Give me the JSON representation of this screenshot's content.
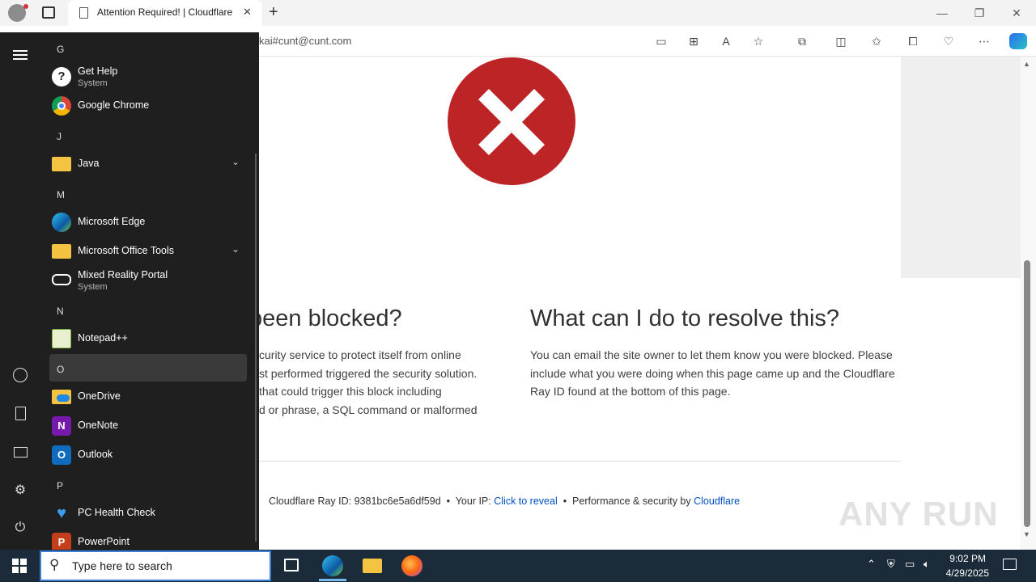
{
  "browser": {
    "tab_title": "Attention Required! | Cloudflare",
    "address": "kai#cunt@cunt.com"
  },
  "page": {
    "heading_left": "been blocked?",
    "heading_right": "What can I do to resolve this?",
    "left_para_lines": [
      "curity service to protect itself from online",
      "st performed triggered the security solution.",
      "that could trigger this block including",
      "d or phrase, a SQL command or malformed"
    ],
    "right_para": "You can email the site owner to let them know you were blocked. Please include what you were doing when this page came up and the Cloudflare Ray ID found at the bottom of this page.",
    "footer": {
      "ray_label": "Cloudflare Ray ID:",
      "ray_id": "9381bc6e5a6df59d",
      "ip_label": "Your IP:",
      "ip_link": "Click to reveal",
      "perf_label": "Performance & security by",
      "cf_link": "Cloudflare"
    },
    "watermark": "ANY RUN"
  },
  "start_menu": {
    "entries": [
      {
        "type": "letter",
        "text": "G"
      },
      {
        "type": "app",
        "name": "Get Help",
        "sub": "System",
        "icon": "help-icon"
      },
      {
        "type": "app",
        "name": "Google Chrome",
        "icon": "chrome-icon"
      },
      {
        "type": "letter",
        "text": "J"
      },
      {
        "type": "app",
        "name": "Java",
        "icon": "folder-icon",
        "expandable": true
      },
      {
        "type": "letter",
        "text": "M"
      },
      {
        "type": "app",
        "name": "Microsoft Edge",
        "icon": "edge-icon"
      },
      {
        "type": "app",
        "name": "Microsoft Office Tools",
        "icon": "folder-icon",
        "expandable": true
      },
      {
        "type": "app",
        "name": "Mixed Reality Portal",
        "sub": "System",
        "icon": "vr-headset-icon"
      },
      {
        "type": "letter",
        "text": "N"
      },
      {
        "type": "app",
        "name": "Notepad++",
        "icon": "notepad-icon"
      },
      {
        "type": "letter",
        "text": "O"
      },
      {
        "type": "app",
        "name": "OneDrive",
        "icon": "onedrive-icon"
      },
      {
        "type": "app",
        "name": "OneNote",
        "icon": "onenote-icon"
      },
      {
        "type": "app",
        "name": "Outlook",
        "icon": "outlook-icon"
      },
      {
        "type": "letter",
        "text": "P"
      },
      {
        "type": "app",
        "name": "PC Health Check",
        "icon": "health-icon"
      },
      {
        "type": "app",
        "name": "PowerPoint",
        "icon": "powerpoint-icon"
      }
    ]
  },
  "taskbar": {
    "search_placeholder": "Type here to search",
    "time": "9:02 PM",
    "date": "4/29/2025"
  },
  "colors": {
    "error_red": "#bd2426",
    "link_blue": "#0051c3",
    "start_bg": "#1f1f1f",
    "taskbar_bg": "#1c2b3a"
  }
}
